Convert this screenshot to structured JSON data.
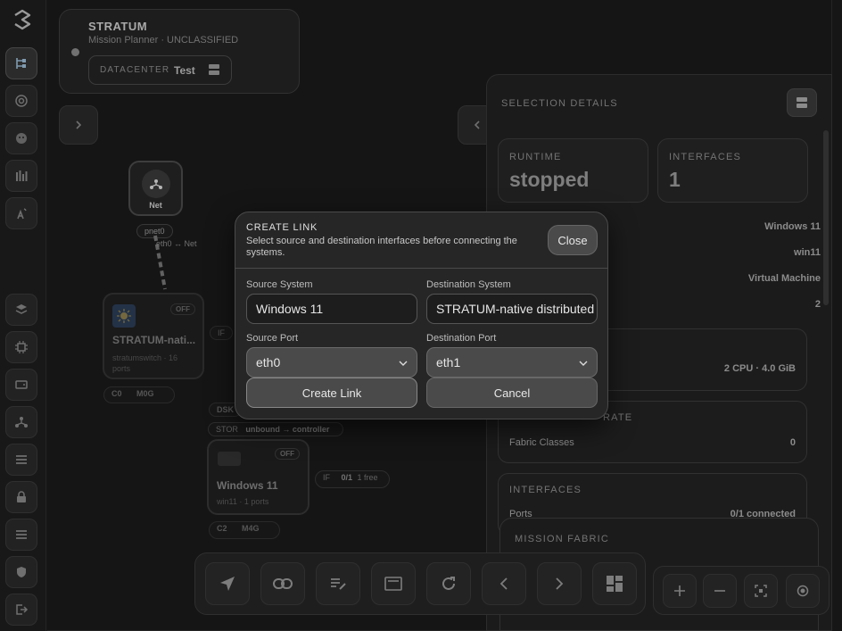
{
  "app": {
    "name": "STRATUM",
    "subtitle": "Mission Planner · UNCLASSIFIED",
    "datacenter_label": "DATACENTER",
    "datacenter_value": "Test"
  },
  "rail": {
    "icons": [
      "stratum-logo-icon",
      "topology-icon",
      "at-sign-icon",
      "puppet-icon",
      "chart-bars-icon",
      "antenna-icon",
      "layers-icon",
      "cpu-icon",
      "storage-drive-icon",
      "network-icon",
      "list-icon",
      "lock-icon",
      "list-alt-icon",
      "shield-gear-icon",
      "logout-icon"
    ]
  },
  "canvas": {
    "net_node": {
      "label": "Net",
      "port": "pnet0",
      "link_label": "eth0 ↔ Net"
    },
    "switch_node": {
      "title": "STRATUM-nati...",
      "sub": "stratumswitch · 16 ports",
      "status": "OFF",
      "chip_c": "C0",
      "chip_m": "M0G",
      "if_label": "IF"
    },
    "dsk_label": "DSK",
    "stor_label": "STOR",
    "stor_value": "unbound → controller",
    "win_node": {
      "title": "Windows 11",
      "sub": "win11 · 1 ports",
      "status": "OFF",
      "chip_c": "C2",
      "chip_m": "M4G"
    },
    "if_pill": {
      "label": "IF",
      "value": "0/1",
      "extra": "1 free"
    }
  },
  "details": {
    "title": "SELECTION DETAILS",
    "runtime_label": "RUNTIME",
    "runtime_value": "stopped",
    "interfaces_label": "INTERFACES",
    "interfaces_value": "1",
    "rows": [
      {
        "value": "Windows 11"
      },
      {
        "value": "win11"
      },
      {
        "value": "Virtual Machine"
      },
      {
        "value": "2"
      }
    ],
    "resources_value": "2 CPU · 4.0 GiB",
    "section_rate_partial": "RATE",
    "fabric_classes_label": "Fabric Classes",
    "fabric_classes_value": "0",
    "interfaces_section": "INTERFACES",
    "ports_label": "Ports",
    "ports_value": "0/1 connected",
    "mission_fabric": "MISSION FABRIC"
  },
  "modal": {
    "title": "CREATE LINK",
    "description": "Select source and destination interfaces before connecting the systems.",
    "close_label": "Close",
    "source_system_label": "Source System",
    "source_system_value": "Windows 11",
    "dest_system_label": "Destination System",
    "dest_system_value": "STRATUM-native distributed",
    "source_port_label": "Source Port",
    "source_port_value": "eth0",
    "dest_port_label": "Destination Port",
    "dest_port_value": "eth1",
    "create_label": "Create Link",
    "cancel_label": "Cancel"
  },
  "toolbar": {
    "icons": [
      "navigate-icon",
      "link-icon",
      "edit-icon",
      "window-icon",
      "refresh-icon",
      "chevron-left-icon",
      "chevron-right-icon",
      "dashboard-icon"
    ],
    "zoom_icons": [
      "zoom-in-icon",
      "zoom-out-icon",
      "fit-view-icon",
      "center-icon"
    ]
  }
}
